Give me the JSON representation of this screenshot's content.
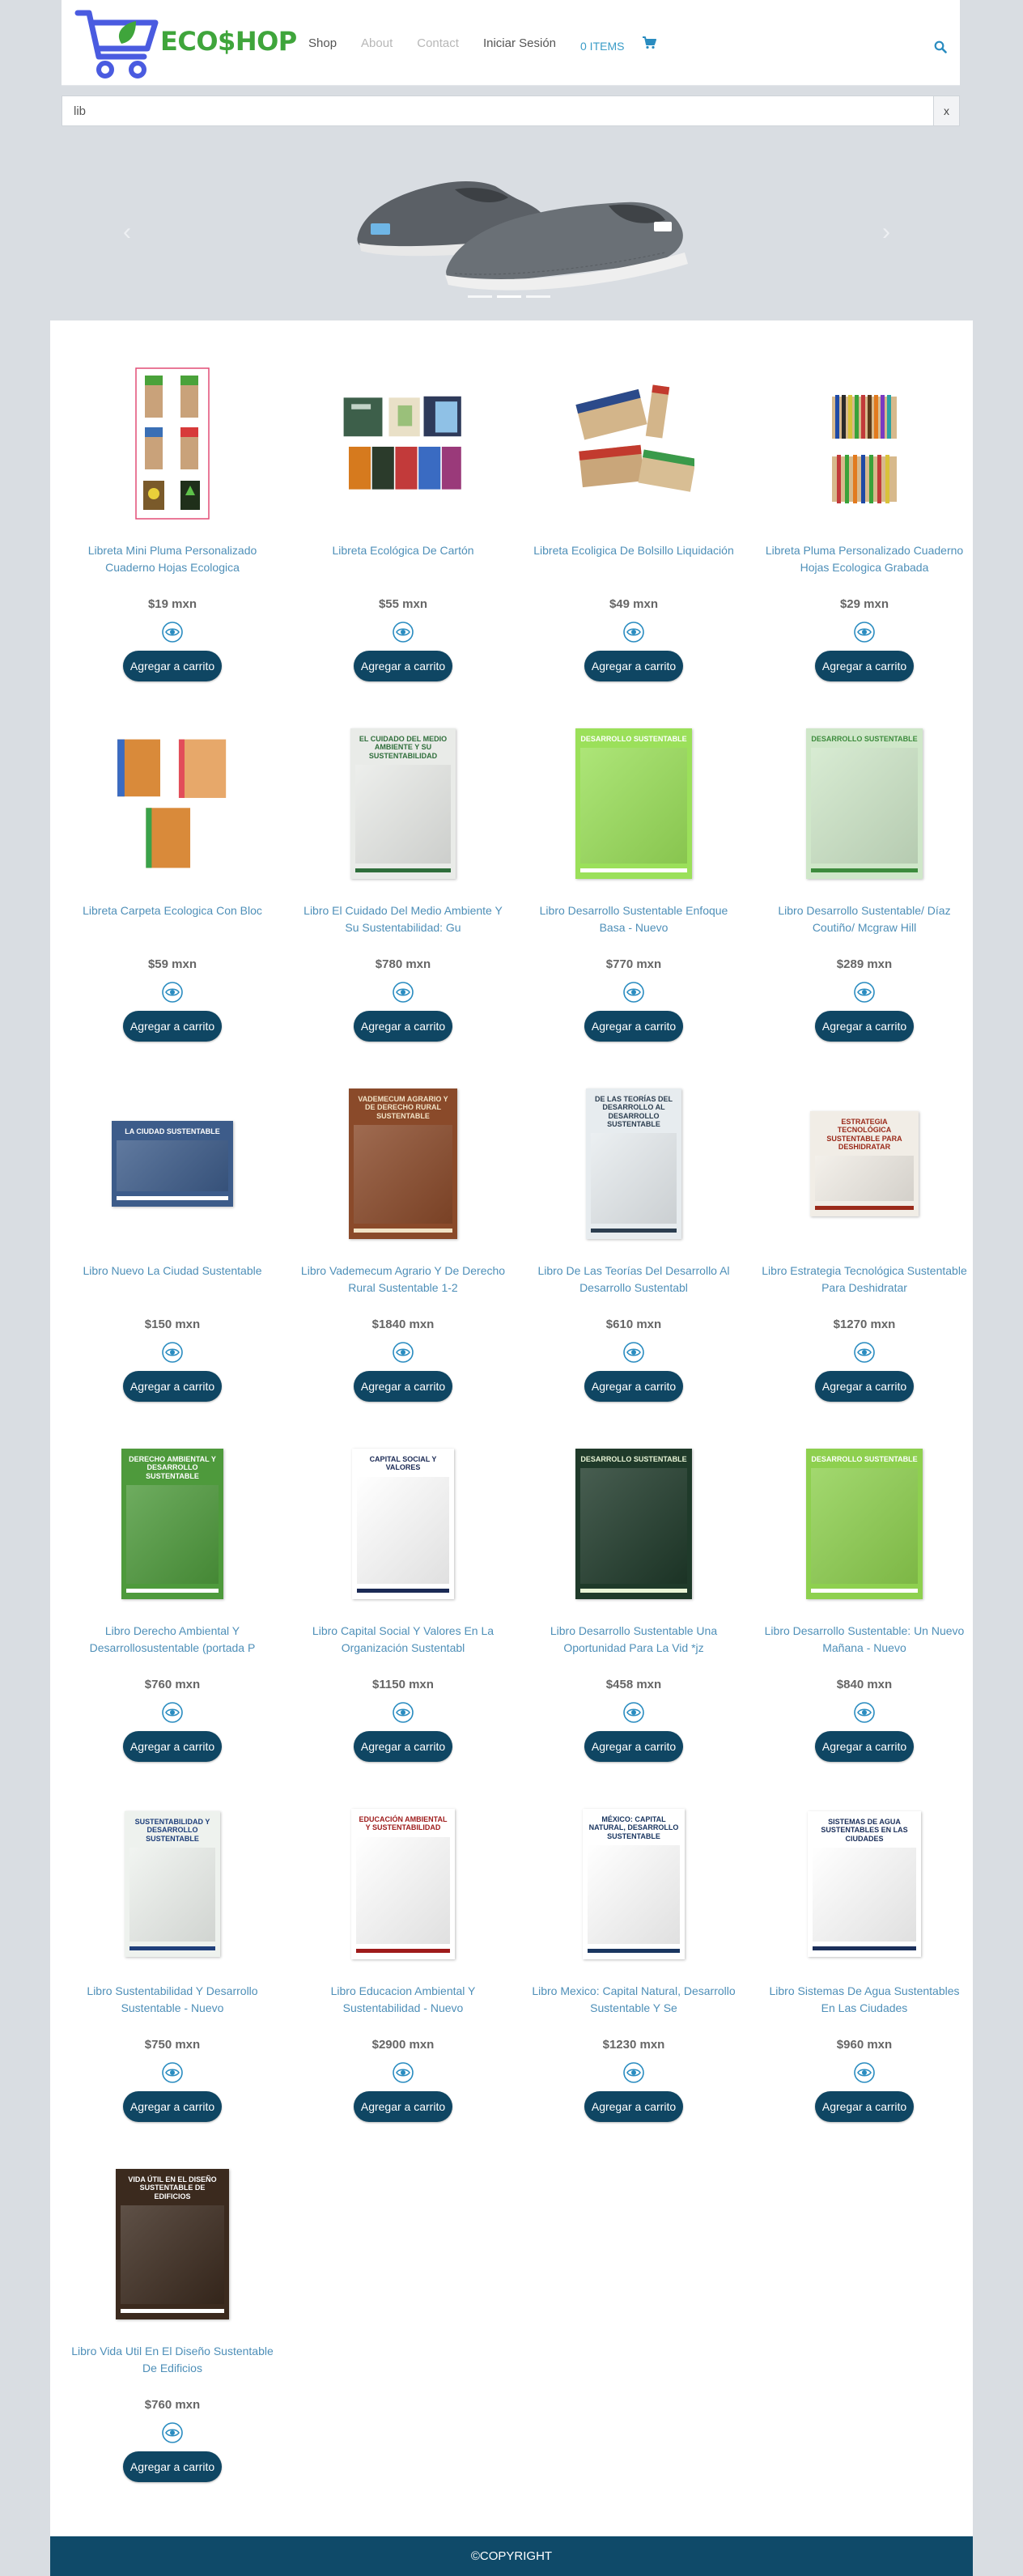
{
  "header": {
    "logo_text": "ECO$HOP",
    "nav": [
      "Shop",
      "About",
      "Contact",
      "Iniciar Sesión"
    ],
    "cart_count": "0 ITEMS",
    "cart_icon": "shopping-cart-icon",
    "search_icon": "search-icon"
  },
  "search": {
    "value": "lib",
    "clear_label": "x"
  },
  "carousel": {
    "prev_icon": "chevron-left-icon",
    "next_icon": "chevron-right-icon",
    "slide_count": 3,
    "active_slide": 2
  },
  "products": [
    {
      "title": "Libreta Mini Pluma Personalizado Cuaderno Hojas Ecologica",
      "price": "$19 mxn"
    },
    {
      "title": "Libreta Ecológica De Cartón",
      "price": "$55 mxn"
    },
    {
      "title": "Libreta Ecoligica De Bolsillo Liquidación",
      "price": "$49 mxn"
    },
    {
      "title": "Libreta Pluma Personalizado Cuaderno Hojas Ecologica Grabada",
      "price": "$29 mxn"
    },
    {
      "title": "Libreta Carpeta Ecologica Con Bloc",
      "price": "$59 mxn"
    },
    {
      "title": "Libro El Cuidado Del Medio Ambiente Y Su Sustentabilidad: Gu",
      "price": "$780 mxn"
    },
    {
      "title": "Libro Desarrollo Sustentable Enfoque Basa - Nuevo",
      "price": "$770 mxn"
    },
    {
      "title": "Libro Desarrollo Sustentable/ Díaz Coutiño/ Mcgraw Hill",
      "price": "$289 mxn"
    },
    {
      "title": "Libro Nuevo La Ciudad Sustentable",
      "price": "$150 mxn"
    },
    {
      "title": "Libro Vademecum Agrario Y De Derecho Rural Sustentable 1-2",
      "price": "$1840 mxn"
    },
    {
      "title": "Libro De Las Teorías Del Desarrollo Al Desarrollo Sustentabl",
      "price": "$610 mxn"
    },
    {
      "title": "Libro Estrategia Tecnológica Sustentable Para Deshidratar",
      "price": "$1270 mxn"
    },
    {
      "title": "Libro Derecho Ambiental Y Desarrollosustentable (portada P",
      "price": "$760 mxn"
    },
    {
      "title": "Libro Capital Social Y Valores En La Organización Sustentabl",
      "price": "$1150 mxn"
    },
    {
      "title": "Libro Desarrollo Sustentable Una Oportunidad Para La Vid *jz",
      "price": "$458 mxn"
    },
    {
      "title": "Libro Desarrollo Sustentable: Un Nuevo Mañana - Nuevo",
      "price": "$840 mxn"
    },
    {
      "title": "Libro Sustentabilidad Y Desarrollo Sustentable - Nuevo",
      "price": "$750 mxn"
    },
    {
      "title": "Libro Educacion Ambiental Y Sustentabilidad - Nuevo",
      "price": "$2900 mxn"
    },
    {
      "title": "Libro Mexico: Capital Natural, Desarrollo Sustentable Y Se",
      "price": "$1230 mxn"
    },
    {
      "title": "Libro Sistemas De Agua Sustentables En Las Ciudades",
      "price": "$960 mxn"
    },
    {
      "title": "Libro Vida Util En El Diseño Sustentable De Edificios",
      "price": "$760 mxn"
    }
  ],
  "card": {
    "add_label": "Agregar a carrito",
    "view_icon": "eye-icon"
  },
  "covers": [
    {
      "text": "",
      "bg": "#ffffff"
    },
    {
      "text": "",
      "bg": "#ffffff"
    },
    {
      "text": "",
      "bg": "#ffffff"
    },
    {
      "text": "",
      "bg": "#ffffff"
    },
    {
      "text": "",
      "bg": "#ffffff"
    },
    {
      "text": "EL CUIDADO DEL MEDIO AMBIENTE Y SU SUSTENTABILIDAD",
      "bg": "#e9ebe8",
      "fg": "#2f6e3b"
    },
    {
      "text": "Desarrollo sustentable",
      "bg": "#9be05a",
      "fg": "#ffffff"
    },
    {
      "text": "Desarrollo sustentable",
      "bg": "#cfe7c9",
      "fg": "#3d8b3d"
    },
    {
      "text": "LA CIUDAD SUSTENTABLE",
      "bg": "#3d5c8a",
      "fg": "#ffffff"
    },
    {
      "text": "VADEMECUM AGRARIO Y DE DERECHO RURAL SUSTENTABLE",
      "bg": "#8a4a2a",
      "fg": "#f2e3c6"
    },
    {
      "text": "De las teorías del desarrollo al desarrollo sustentable",
      "bg": "#e7ecef",
      "fg": "#2c3e50"
    },
    {
      "text": "ESTRATEGIA TECNOLÓGICA SUSTENTABLE PARA DESHIDRATAR",
      "bg": "#f1ede6",
      "fg": "#9a2a1a"
    },
    {
      "text": "DERECHO AMBIENTAL Y DESARROLLO SUSTENTABLE",
      "bg": "#4e9a3c",
      "fg": "#ffffff"
    },
    {
      "text": "CAPITAL SOCIAL Y VALORES",
      "bg": "#ffffff",
      "fg": "#1b2a55"
    },
    {
      "text": "Desarrollo sustentable",
      "bg": "#1f3a2a",
      "fg": "#e9f5d6"
    },
    {
      "text": "Desarrollo sustentable",
      "bg": "#8ed04f",
      "fg": "#ffffff"
    },
    {
      "text": "SUSTENTABILIDAD Y DESARROLLO SUSTENTABLE",
      "bg": "#eef2ee",
      "fg": "#1f3f7a"
    },
    {
      "text": "Educación ambiental y sustentabilidad",
      "bg": "#ffffff",
      "fg": "#9e1b1b"
    },
    {
      "text": "México: capital natural, desarrollo sustentable",
      "bg": "#ffffff",
      "fg": "#1a3660"
    },
    {
      "text": "SISTEMAS DE AGUA SUSTENTABLES EN LAS CIUDADES",
      "bg": "#ffffff",
      "fg": "#1b2f5a"
    },
    {
      "text": "VIDA ÚTIL EN EL DISEÑO SUSTENTABLE DE EDIFICIOS",
      "bg": "#3b2a1e",
      "fg": "#ffffff"
    }
  ],
  "footer": {
    "text": "©COPYRIGHT"
  }
}
